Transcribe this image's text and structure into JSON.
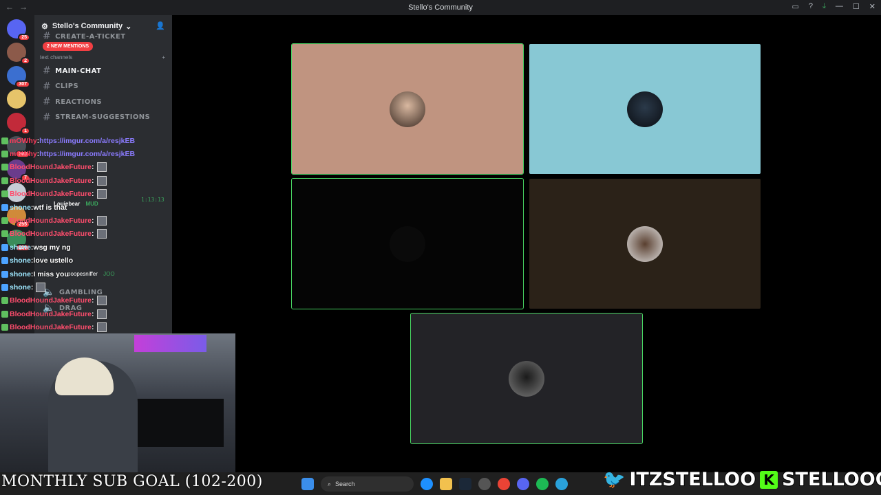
{
  "window": {
    "title": "Stello's Community"
  },
  "server": {
    "name": "Stello's Community",
    "mentions_badge": "2 NEW MENTIONS"
  },
  "channels": {
    "ticket": "CREATE-A-TICKET",
    "category": "text channels",
    "items": [
      {
        "label": "MAIN-CHAT",
        "active": true
      },
      {
        "label": "CLIPS",
        "active": false
      },
      {
        "label": "REACTIONS",
        "active": false
      },
      {
        "label": "STREAM-SUGGESTIONS",
        "active": false
      }
    ],
    "vc_time": "1:13:13",
    "vc_user": "Louiebear",
    "vc_user_badge": "MUD",
    "vc_user2": "poopesniffer",
    "vc_user2_badge": "JOO",
    "vc_gambling": "GAMBLING",
    "vc_drag": "DRAG"
  },
  "guild_badges": [
    "25",
    "2",
    "307",
    "1",
    "363",
    "7",
    "255",
    "200"
  ],
  "chat": [
    {
      "user": "mOWhy",
      "text": "https://imgur.com/a/resjkEB",
      "kind": "link",
      "color": "#ff3b5c"
    },
    {
      "user": "mOWhy",
      "text": "https://imgur.com/a/resjkEB",
      "kind": "link",
      "color": "#ff3b5c"
    },
    {
      "user": "BloodHoundJakeFuture",
      "text": "",
      "kind": "emote",
      "color": "#ff4d6d"
    },
    {
      "user": "BloodHoundJakeFuture",
      "text": "",
      "kind": "emote",
      "color": "#ff4d6d"
    },
    {
      "user": "BloodHoundJakeFuture",
      "text": "",
      "kind": "emote",
      "color": "#ff4d6d"
    },
    {
      "user": "shone",
      "text": "wtf is that",
      "kind": "text",
      "color": "#9fe8ff"
    },
    {
      "user": "BloodHoundJakeFuture",
      "text": "",
      "kind": "emote",
      "color": "#ff4d6d"
    },
    {
      "user": "BloodHoundJakeFuture",
      "text": "",
      "kind": "emote",
      "color": "#ff4d6d"
    },
    {
      "user": "shone",
      "text": "wsg my ng",
      "kind": "text",
      "color": "#9fe8ff"
    },
    {
      "user": "shone",
      "text": "love ustello",
      "kind": "text",
      "color": "#9fe8ff"
    },
    {
      "user": "shone",
      "text": "I miss you",
      "kind": "text",
      "color": "#9fe8ff"
    },
    {
      "user": "shone",
      "text": "",
      "kind": "emote",
      "color": "#9fe8ff"
    },
    {
      "user": "BloodHoundJakeFuture",
      "text": "",
      "kind": "emote",
      "color": "#ff4d6d"
    },
    {
      "user": "BloodHoundJakeFuture",
      "text": "",
      "kind": "emote",
      "color": "#ff4d6d"
    },
    {
      "user": "BloodHoundJakeFuture",
      "text": "",
      "kind": "emote",
      "color": "#ff4d6d"
    }
  ],
  "tiles": [
    {
      "name": "participant-1",
      "bg": "#c09480",
      "speaking": true
    },
    {
      "name": "participant-2",
      "bg": "#88c8d4",
      "speaking": false
    },
    {
      "name": "participant-3",
      "bg": "#050505",
      "speaking": true
    },
    {
      "name": "participant-4",
      "bg": "#2b2218",
      "speaking": false
    },
    {
      "name": "participant-5",
      "bg": "#232327",
      "speaking": true
    }
  ],
  "overlay": {
    "sub_goal": "MONTHLY SUB GOAL (102-200)",
    "twitter": "ITZSTELLOO",
    "kick": "STELLOOO"
  },
  "taskbar": {
    "search_placeholder": "Search"
  }
}
